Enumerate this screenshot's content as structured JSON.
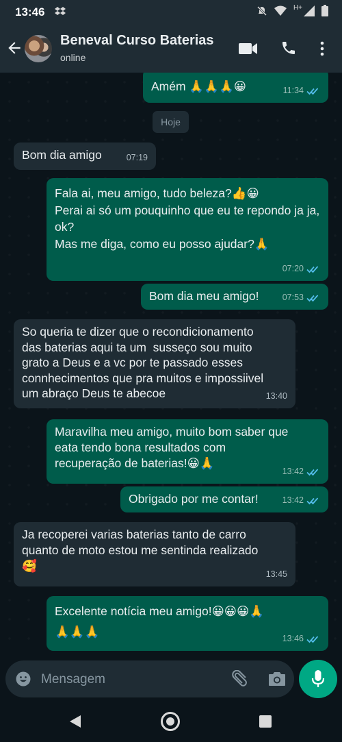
{
  "status_bar": {
    "time": "13:46",
    "network": "H+"
  },
  "header": {
    "contact_name": "Beneval Curso Baterias",
    "status": "online"
  },
  "chat": {
    "day_separator": "Hoje",
    "messages": [
      {
        "dir": "out",
        "text": "Amém 🙏🙏🙏😀",
        "time": "11:34",
        "read": true
      },
      {
        "dir": "in",
        "text": "Bom dia amigo",
        "time": "07:19"
      },
      {
        "dir": "out",
        "text": "Fala ai, meu amigo, tudo beleza?👍😀\nPerai ai só um pouquinho que eu te repondo ja ja, ok?\nMas me diga, como eu posso ajudar?🙏",
        "time": "07:20",
        "read": true
      },
      {
        "dir": "out",
        "text": "Bom dia meu amigo!",
        "time": "07:53",
        "read": true
      },
      {
        "dir": "in",
        "text": "So queria te dizer que o recondicionamento das baterias aqui ta um  susseço sou muito grato a Deus e a vc por te passado esses connhecimentos que pra muitos e impossiivel um abraço Deus te abecoe",
        "time": "13:40"
      },
      {
        "dir": "out",
        "text": "Maravilha meu amigo, muito bom saber que eata tendo bona resultados com recuperação de baterias!😀🙏",
        "time": "13:42",
        "read": true
      },
      {
        "dir": "out",
        "text": "Obrigado por me contar!",
        "time": "13:42",
        "read": true
      },
      {
        "dir": "in",
        "text": "Ja recoperei varias baterias tanto de carro quanto de moto estou me sentinda realizado\n🥰",
        "time": "13:45"
      },
      {
        "dir": "out",
        "text": "Excelente notícia meu amigo!😀😀😀🙏\n🙏🙏🙏",
        "time": "13:46",
        "read": true
      }
    ]
  },
  "composer": {
    "placeholder": "Mensagem"
  },
  "icons": {
    "back": "arrow-left-icon",
    "video": "video-call-icon",
    "phone": "phone-icon",
    "menu": "more-vert-icon",
    "emoji": "emoji-icon",
    "attach": "paperclip-icon",
    "camera": "camera-icon",
    "mic": "mic-icon"
  },
  "colors": {
    "outgoing_bubble": "#005c4b",
    "incoming_bubble": "#1f2c34",
    "accent": "#00a884",
    "read_ticks": "#53bdeb"
  }
}
